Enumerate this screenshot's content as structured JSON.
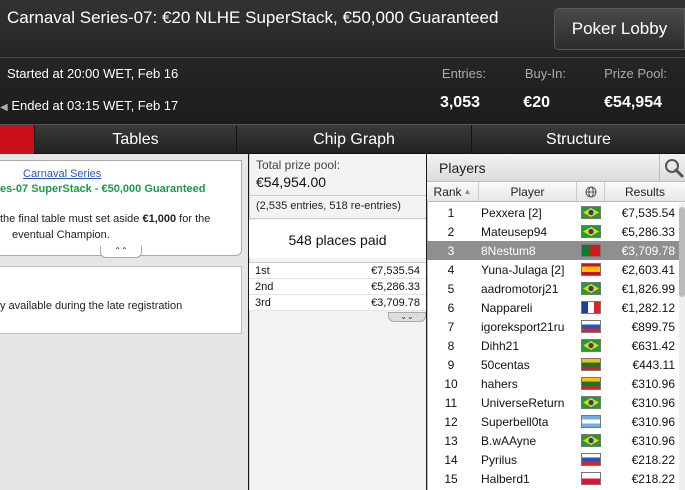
{
  "header": {
    "title": "Carnaval Series-07: €20 NLHE SuperStack, €50,000 Guaranteed",
    "lobby_button": "Poker Lobby",
    "started": "Started at 20:00 WET, Feb 16",
    "ended": "Ended at 03:15 WET, Feb 17",
    "stats": {
      "entries_label": "Entries:",
      "entries_value": "3,053",
      "buyin_label": "Buy-In:",
      "buyin_value": "€20",
      "prize_label": "Prize Pool:",
      "prize_value": "€54,954"
    }
  },
  "tabs": [
    "Tables",
    "Chip Graph",
    "Structure"
  ],
  "info": {
    "series_link": "Carnaval Series",
    "series_name_a": "es-07 SuperStack",
    "series_name_sep": " - ",
    "series_name_b": "€50,000 Guaranteed",
    "final_table_1": "the final table must set aside ",
    "final_table_amount": "€1,000",
    "final_table_2": " for the",
    "final_table_3": "eventual Champion.",
    "late_reg": "y available during the late registration"
  },
  "prize": {
    "label": "Total prize pool:",
    "value": "€54,954.00",
    "entries": "(2,535 entries, 518 re-entries)",
    "places_paid": "548 places paid",
    "payouts": [
      {
        "place": "1st",
        "amount": "€7,535.54"
      },
      {
        "place": "2nd",
        "amount": "€5,286.33"
      },
      {
        "place": "3rd",
        "amount": "€3,709.78"
      }
    ]
  },
  "players": {
    "title": "Players",
    "columns": {
      "rank": "Rank",
      "player": "Player",
      "results": "Results"
    },
    "rows": [
      {
        "rank": "1",
        "name": "Pexxera [2]",
        "country": "brazil",
        "result": "€7,535.54"
      },
      {
        "rank": "2",
        "name": "Mateusep94",
        "country": "brazil",
        "result": "€5,286.33"
      },
      {
        "rank": "3",
        "name": "8Nestum8",
        "country": "portugal",
        "result": "€3,709.78",
        "selected": true
      },
      {
        "rank": "4",
        "name": "Yuna-Julaga [2]",
        "country": "spain",
        "result": "€2,603.41"
      },
      {
        "rank": "5",
        "name": "aadromotorj21",
        "country": "brazil",
        "result": "€1,826.99"
      },
      {
        "rank": "6",
        "name": "Nappareli",
        "country": "france",
        "result": "€1,282.12"
      },
      {
        "rank": "7",
        "name": "igoreksport21ru",
        "country": "russia",
        "result": "€899.75"
      },
      {
        "rank": "8",
        "name": "Dihh21",
        "country": "brazil",
        "result": "€631.42"
      },
      {
        "rank": "9",
        "name": "50centas",
        "country": "lithuania",
        "result": "€443.11"
      },
      {
        "rank": "10",
        "name": "hahers",
        "country": "lithuania",
        "result": "€310.96"
      },
      {
        "rank": "11",
        "name": "UniverseReturn",
        "country": "brazil",
        "result": "€310.96"
      },
      {
        "rank": "12",
        "name": "Superbell0ta",
        "country": "argentina",
        "result": "€310.96"
      },
      {
        "rank": "13",
        "name": "B.wAAyne",
        "country": "brazil",
        "result": "€310.96"
      },
      {
        "rank": "14",
        "name": "Pyrilus",
        "country": "russia",
        "result": "€218.22"
      },
      {
        "rank": "15",
        "name": "Halberd1",
        "country": "poland",
        "result": "€218.22"
      }
    ]
  },
  "colors": {
    "accent_red": "#c9101a",
    "link_blue": "#2a56b8",
    "guarantee_green": "#1a9a4a",
    "selected_row": "#8f8f8f"
  }
}
